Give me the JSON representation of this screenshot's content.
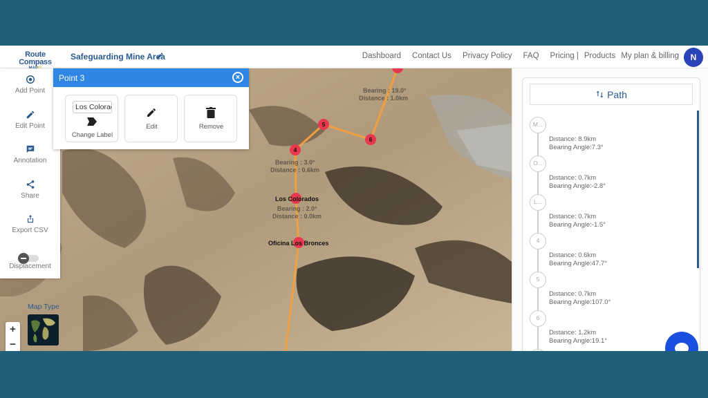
{
  "header": {
    "logo_main": "Route Compass",
    "logo_sub_a": "MAP",
    "logo_sub_b": "IS",
    "project_title": "Safeguarding Mine Area",
    "nav": [
      "Dashboard",
      "Contact Us",
      "Privacy Policy",
      "FAQ",
      "Pricing |",
      "Products",
      "My plan & billing"
    ],
    "avatar_initial": "N"
  },
  "toolbar": {
    "items": [
      {
        "label": "Add Point",
        "icon": "add-point-icon"
      },
      {
        "label": "Edit Point",
        "icon": "pencil-icon"
      },
      {
        "label": "Annotation",
        "icon": "comment-icon"
      },
      {
        "label": "Share",
        "icon": "share-icon"
      },
      {
        "label": "Export CSV",
        "icon": "export-icon"
      }
    ],
    "toggle_label": "Displacement",
    "toggle_on": false
  },
  "popup": {
    "title": "Point 3",
    "label_value": "Los Colorados",
    "change_label": "Change Label",
    "edit_label": "Edit",
    "remove_label": "Remove"
  },
  "map": {
    "zoom_in": "+",
    "zoom_out": "−",
    "compass": "▲",
    "map_type_label": "Map Type",
    "markers": [
      {
        "id": "4",
        "label": "4"
      },
      {
        "id": "5",
        "label": "5"
      },
      {
        "id": "6",
        "label": "6"
      },
      {
        "id": "3",
        "label": ""
      },
      {
        "id": "2",
        "label": ""
      }
    ],
    "place_labels": {
      "los_colorados": "Los Colorados",
      "oficina": "Oficina Los Bronces"
    },
    "segment_labels": {
      "top_bearing": "Bearing : 19.0°",
      "top_distance": "Distance : 1.0km",
      "mid_bearing": "Bearing : 3.0°",
      "mid_distance": "Distance : 0.6km",
      "low_bearing": "Bearing : 2.0°",
      "low_distance": "Distance : 0.0km"
    },
    "route_color": "#f0a040",
    "marker_color": "#e8384f"
  },
  "path_panel": {
    "title": "Path",
    "steps": [
      {
        "node": "M...",
        "distance": "Distance: 8.9km",
        "bearing": "Bearing Angle:7.3°"
      },
      {
        "node": "O...",
        "distance": "Distance: 0.7km",
        "bearing": "Bearing Angle:-2.8°"
      },
      {
        "node": "L...",
        "distance": "Distance: 0.7km",
        "bearing": "Bearing Angle:-1.5°"
      },
      {
        "node": "4",
        "distance": "Distance: 0.6km",
        "bearing": "Bearing Angle:47.7°"
      },
      {
        "node": "5",
        "distance": "Distance: 0.7km",
        "bearing": "Bearing Angle:107.0°"
      },
      {
        "node": "6",
        "distance": "Distance: 1.2km",
        "bearing": "Bearing Angle:19.1°"
      }
    ]
  }
}
